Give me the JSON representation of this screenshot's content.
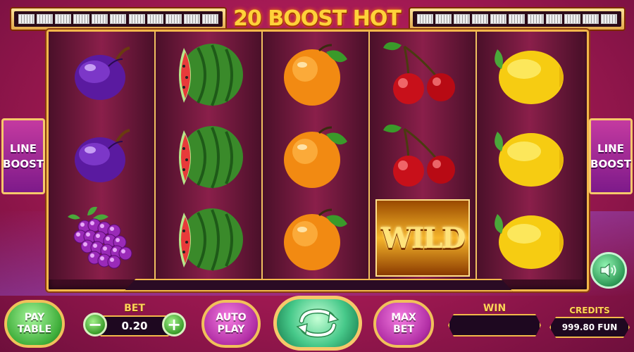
{
  "game": {
    "title": "20 BOOST HOT",
    "paylines_left_count": 11,
    "paylines_right_count": 11
  },
  "side_buttons": {
    "left_label_line1": "LINE",
    "left_label_line2": "BOOST",
    "right_label_line1": "LINE",
    "right_label_line2": "BOOST"
  },
  "reels": [
    [
      "plum",
      "plum",
      "grapes"
    ],
    [
      "watermelon",
      "watermelon",
      "watermelon"
    ],
    [
      "orange",
      "orange",
      "orange"
    ],
    [
      "cherries",
      "cherries",
      "wild"
    ],
    [
      "lemon",
      "lemon",
      "lemon"
    ]
  ],
  "wild_label": "WILD",
  "controls": {
    "paytable_line1": "PAY",
    "paytable_line2": "TABLE",
    "bet_label": "BET",
    "bet_value": "0.20",
    "minus_icon": "−",
    "plus_icon": "+",
    "autoplay_line1": "AUTO",
    "autoplay_line2": "PLAY",
    "spin_icon": "spin-arrows-icon",
    "maxbet_line1": "MAX",
    "maxbet_line2": "BET",
    "win_label": "WIN",
    "win_value": "",
    "credits_label": "CREDITS",
    "credits_value": "999.80 FUN"
  },
  "colors": {
    "gold_border": "#f2b84a",
    "background": "#a71a55",
    "green_button": "#3fae3a",
    "purple_button": "#b12ea5"
  }
}
